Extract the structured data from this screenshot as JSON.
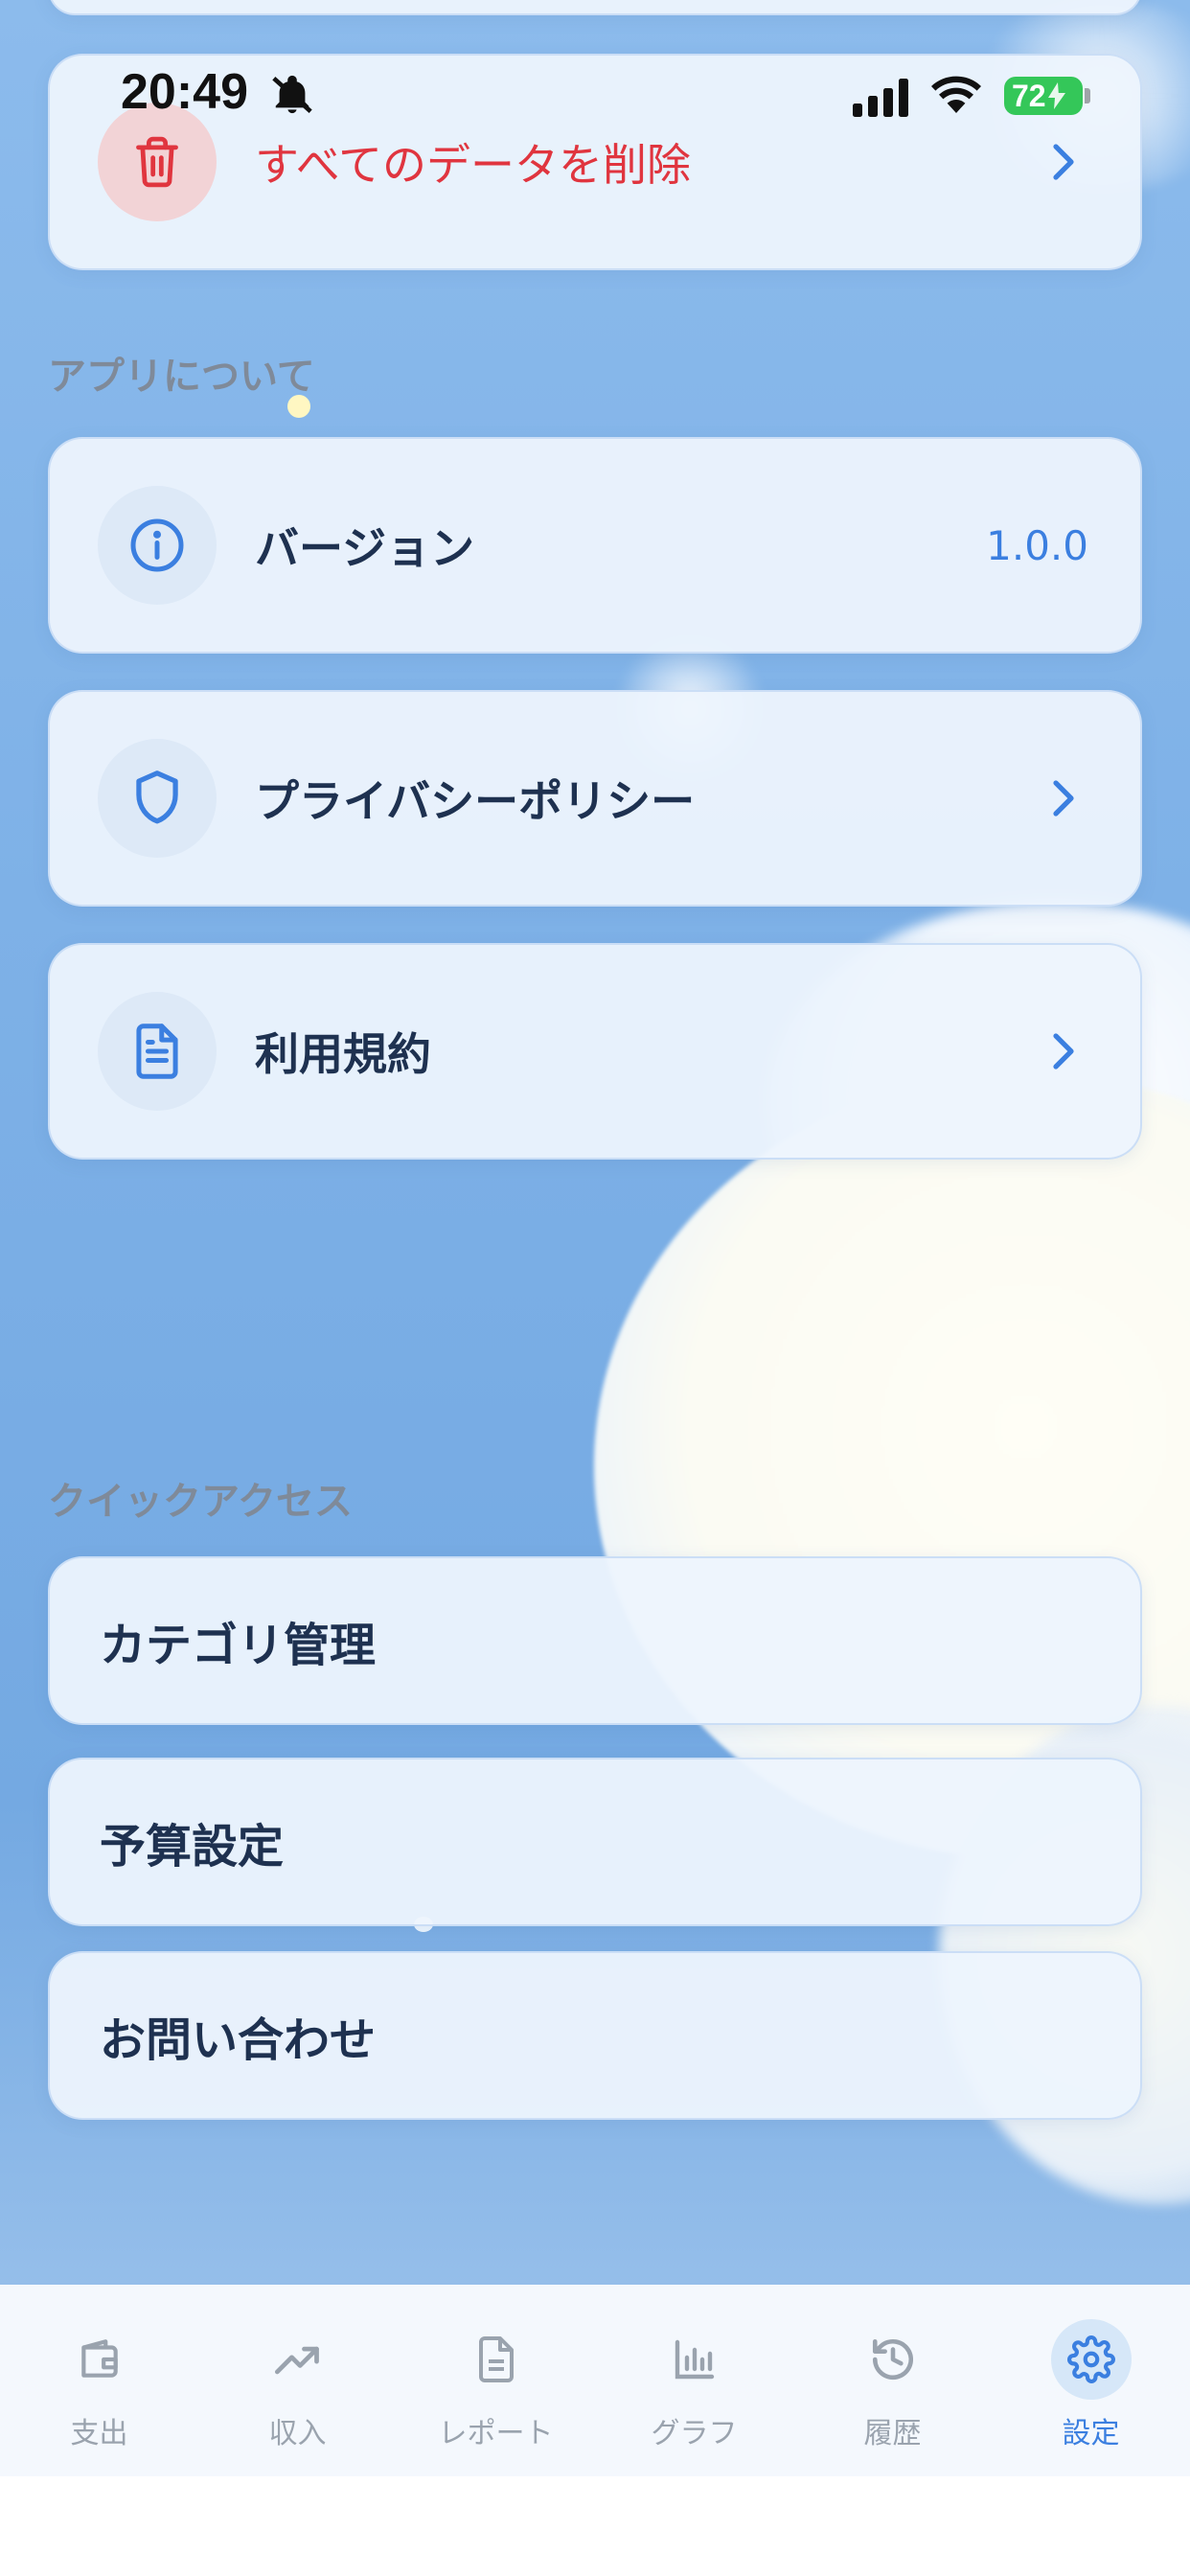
{
  "status_bar": {
    "time": "20:49",
    "battery": "72"
  },
  "data_section": {
    "delete_all": {
      "label": "すべてのデータを削除",
      "icon": "trash-icon"
    }
  },
  "about": {
    "title": "アプリについて",
    "version": {
      "label": "バージョン",
      "value": "1.0.0",
      "icon": "info-icon"
    },
    "privacy": {
      "label": "プライバシーポリシー",
      "icon": "shield-icon"
    },
    "terms": {
      "label": "利用規約",
      "icon": "document-icon"
    }
  },
  "quick_access": {
    "title": "クイックアクセス",
    "items": [
      {
        "label": "カテゴリ管理"
      },
      {
        "label": "予算設定"
      },
      {
        "label": "お問い合わせ"
      }
    ]
  },
  "tabbar": {
    "items": [
      {
        "label": "支出",
        "icon": "wallet-icon",
        "active": false
      },
      {
        "label": "収入",
        "icon": "trending-up-icon",
        "active": false
      },
      {
        "label": "レポート",
        "icon": "file-text-icon",
        "active": false
      },
      {
        "label": "グラフ",
        "icon": "bar-chart-icon",
        "active": false
      },
      {
        "label": "履歴",
        "icon": "history-icon",
        "active": false
      },
      {
        "label": "設定",
        "icon": "gear-icon",
        "active": true
      }
    ]
  },
  "colors": {
    "accent": "#3b7fe0",
    "danger": "#e0353f",
    "text": "#1e3150"
  }
}
